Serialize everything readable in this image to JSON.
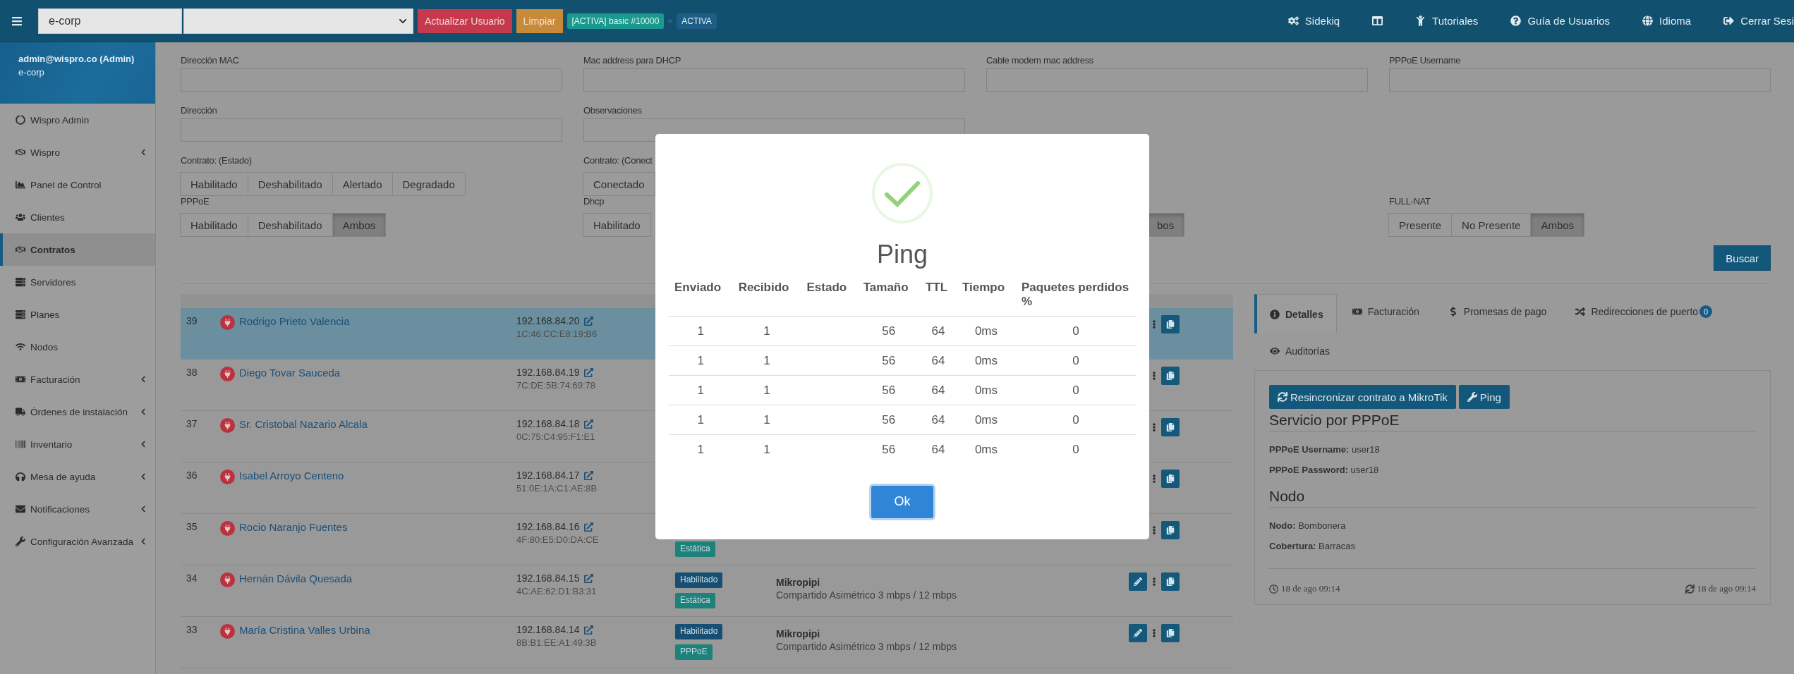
{
  "navbar": {
    "search_value": "e-corp",
    "buttons": [
      {
        "label": "Actualizar Usuario",
        "kind": "danger"
      },
      {
        "label": "Limpiar",
        "kind": "warning"
      }
    ],
    "badges": [
      {
        "label": "[ACTIVA] basic #10000",
        "color": "#1a9a8f"
      },
      {
        "label": "ACTIVA",
        "color": "#1d5d86"
      }
    ],
    "links": [
      {
        "kind": "text",
        "label": "Sidekiq"
      },
      {
        "kind": "icon"
      },
      {
        "kind": "text",
        "label": "Tutoriales"
      },
      {
        "kind": "text",
        "label": "Guía de Usuarios"
      },
      {
        "kind": "text",
        "label": "Idioma"
      },
      {
        "kind": "text",
        "label": "Cerrar Sesi"
      }
    ]
  },
  "sidebar": {
    "user": "admin@wispro.co (Admin)",
    "company": "e-corp",
    "items": [
      {
        "label": "Wispro Admin",
        "submenu": false,
        "selected": false
      },
      {
        "label": "Wispro",
        "submenu": true,
        "selected": false
      },
      {
        "label": "Panel de Control",
        "submenu": false,
        "selected": false
      },
      {
        "label": "Clientes",
        "submenu": false,
        "selected": false
      },
      {
        "label": "Contratos",
        "submenu": false,
        "selected": true
      },
      {
        "label": "Servidores",
        "submenu": false,
        "selected": false
      },
      {
        "label": "Planes",
        "submenu": false,
        "selected": false
      },
      {
        "label": "Nodos",
        "submenu": false,
        "selected": false
      },
      {
        "label": "Facturación",
        "submenu": true,
        "selected": false
      },
      {
        "label": "Órdenes de instalación",
        "submenu": true,
        "selected": false
      },
      {
        "label": "Inventario",
        "submenu": true,
        "selected": false
      },
      {
        "label": "Mesa de ayuda",
        "submenu": true,
        "selected": false
      },
      {
        "label": "Notificaciones",
        "submenu": true,
        "selected": false
      },
      {
        "label": "Configuración Avanzada",
        "submenu": true,
        "selected": false
      }
    ]
  },
  "filters": {
    "rows": [
      [
        {
          "kind": "input",
          "label": "Dirección MAC"
        },
        {
          "kind": "input",
          "label": "Mac address para DHCP"
        },
        {
          "kind": "input",
          "label": "Cable modem mac address"
        },
        {
          "kind": "input",
          "label": "PPPoE Username"
        }
      ],
      [
        {
          "kind": "input",
          "label": "Dirección"
        },
        {
          "kind": "input",
          "label": "Observaciones"
        }
      ],
      [
        {
          "kind": "buttons",
          "label": "Contrato: (Estado)",
          "options": [
            {
              "label": "Habilitado",
              "selected": false
            },
            {
              "label": "Deshabilitado",
              "selected": false
            },
            {
              "label": "Alertado",
              "selected": false
            },
            {
              "label": "Degradado",
              "selected": false
            }
          ]
        },
        {
          "kind": "buttons",
          "label": "Contrato: (Conect",
          "options": [
            {
              "label": "Conectado",
              "selected": false
            }
          ]
        }
      ],
      [
        {
          "kind": "buttons",
          "label": "PPPoE",
          "options": [
            {
              "label": "Habilitado",
              "selected": false
            },
            {
              "label": "Deshabilitado",
              "selected": false
            },
            {
              "label": "Ambos",
              "selected": true
            }
          ]
        },
        {
          "kind": "buttons",
          "label": "Dhcp",
          "options": [
            {
              "label": "Habilitado",
              "selected": false
            }
          ]
        },
        {
          "kind": "buttons",
          "options": [
            {
              "label": "bos",
              "selected": true
            }
          ]
        },
        {
          "kind": "buttons",
          "label": "FULL-NAT",
          "options": [
            {
              "label": "Presente",
              "selected": false
            },
            {
              "label": "No Presente",
              "selected": false
            },
            {
              "label": "Ambos",
              "selected": true
            }
          ]
        }
      ]
    ],
    "search_button": "Buscar"
  },
  "contracts": [
    {
      "id": "39",
      "name": "Rodrigo Prieto Valencia",
      "ip": "192.168.84.20",
      "mac": "1C:46:CC:E8:19:B6",
      "selected": true,
      "actions": [
        {
          "kind": "menu"
        },
        {
          "kind": "copy"
        }
      ]
    },
    {
      "id": "38",
      "name": "Diego Tovar Sauceda",
      "ip": "192.168.84.19",
      "mac": "7C:DE:5B:74:69:78",
      "selected": false,
      "actions": [
        {
          "kind": "menu"
        },
        {
          "kind": "copy"
        }
      ]
    },
    {
      "id": "37",
      "name": "Sr. Cristobal Nazario Alcala",
      "ip": "192.168.84.18",
      "mac": "0C:75:C4:95:F1:E1",
      "selected": false,
      "actions": [
        {
          "kind": "menu"
        },
        {
          "kind": "copy"
        }
      ]
    },
    {
      "id": "36",
      "name": "Isabel Arroyo Centeno",
      "ip": "192.168.84.17",
      "mac": "51:0E:1A:C1:AE:8B",
      "selected": false,
      "actions": [
        {
          "kind": "menu"
        },
        {
          "kind": "copy"
        }
      ]
    },
    {
      "id": "35",
      "name": "Rocio Naranjo Fuentes",
      "ip": "192.168.84.16",
      "mac": "4F:80:E5:D0:DA:CE",
      "selected": false,
      "badges": [
        {
          "kind": "type",
          "label": "Estática"
        }
      ],
      "actions": [
        {
          "kind": "menu"
        },
        {
          "kind": "copy"
        }
      ]
    },
    {
      "id": "34",
      "name": "Hernán Dávila Quesada",
      "ip": "192.168.84.15",
      "mac": "4C:AE:62:D1:B3:31",
      "selected": false,
      "badges": [
        {
          "kind": "status",
          "label": "Habilitado"
        },
        {
          "kind": "type",
          "label": "Estática"
        }
      ],
      "plan": "Mikropipi",
      "plan_detail": "Compartido Asimétrico 3 mbps / 12 mbps",
      "actions": [
        {
          "kind": "edit"
        },
        {
          "kind": "menu"
        },
        {
          "kind": "copy"
        }
      ]
    },
    {
      "id": "33",
      "name": "María Cristina Valles Urbina",
      "ip": "192.168.84.14",
      "mac": "8B:B1:EE:A1:49:3B",
      "selected": false,
      "badges": [
        {
          "kind": "status",
          "label": "Habilitado"
        },
        {
          "kind": "type",
          "label": "PPPoE"
        }
      ],
      "plan": "Mikropipi",
      "plan_detail": "Compartido Asimétrico 3 mbps / 12 mbps",
      "actions": [
        {
          "kind": "edit"
        },
        {
          "kind": "menu"
        },
        {
          "kind": "copy"
        }
      ]
    }
  ],
  "details": {
    "tabs": [
      {
        "label": "Detalles",
        "selected": true
      },
      {
        "label": "Facturación",
        "selected": false
      },
      {
        "label": "Promesas de pago",
        "selected": false
      },
      {
        "label": "Redirecciones de puerto",
        "count": "0",
        "selected": false
      },
      {
        "label": "Auditorías",
        "selected": false
      }
    ],
    "buttons": [
      "Resincronizar contrato a MikroTik",
      "Ping"
    ],
    "sections": [
      {
        "title": "Servicio por PPPoE",
        "fields": [
          "**PPPoE Username:** user18",
          "**PPPoE Password:** user18"
        ]
      },
      {
        "title": "Nodo",
        "fields": [
          "**Nodo:** Bombonera",
          "**Cobertura:** Barracas"
        ]
      }
    ],
    "created": "18 de ago 09:14",
    "updated": "18 de ago 09:14"
  },
  "modal": {
    "title": "Ping",
    "columns": [
      "Enviado",
      "Recibido",
      "Estado",
      "Tamaño",
      "TTL",
      "Tiempo",
      "Paquetes perdidos %"
    ],
    "rows": [
      [
        "1",
        "1",
        null,
        "56",
        "64",
        "0ms",
        "0"
      ],
      [
        "1",
        "1",
        null,
        "56",
        "64",
        "0ms",
        "0"
      ],
      [
        "1",
        "1",
        null,
        "56",
        "64",
        "0ms",
        "0"
      ],
      [
        "1",
        "1",
        null,
        "56",
        "64",
        "0ms",
        "0"
      ],
      [
        "1",
        "1",
        null,
        "56",
        "64",
        "0ms",
        "0"
      ]
    ],
    "button": "Ok"
  }
}
